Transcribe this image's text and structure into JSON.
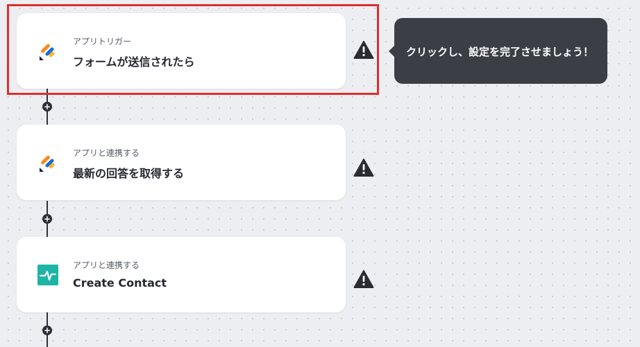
{
  "colors": {
    "highlight": "#e02d2d",
    "tooltip_bg": "#3b3e45",
    "line": "#2d2f36",
    "jotform_blue": "#1a6cd6",
    "jotform_orange": "#f78a1d",
    "jotform_yellow": "#ffb629",
    "jotform_navy": "#0c1a3c",
    "tooltip_app_teal": "#1cb5a6"
  },
  "steps": [
    {
      "subtitle": "アプリトリガー",
      "title": "フォームが送信されたら",
      "icon": "jotform-icon"
    },
    {
      "subtitle": "アプリと連携する",
      "title": "最新の回答を取得する",
      "icon": "jotform-icon"
    },
    {
      "subtitle": "アプリと連携する",
      "title": "Create Contact",
      "icon": "teal-app-icon"
    }
  ],
  "tooltip": {
    "text": "クリックし、設定を完了させましょう！"
  },
  "connector": {
    "plus_symbol": "+"
  }
}
